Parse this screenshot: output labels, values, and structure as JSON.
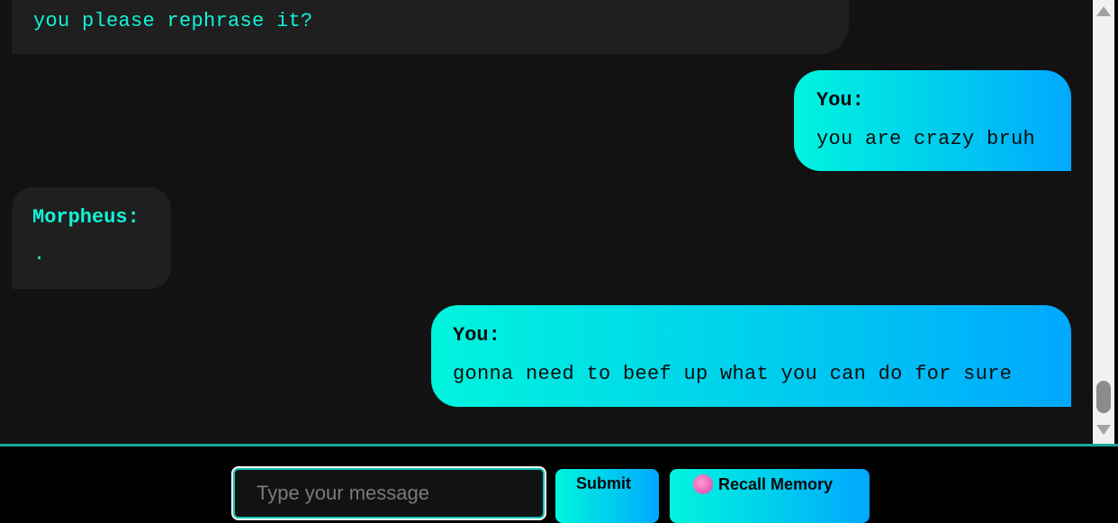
{
  "conversation": {
    "messages": [
      {
        "role": "bot",
        "speaker": "",
        "text": "you please rephrase it?"
      },
      {
        "role": "user",
        "speaker": "You:",
        "text": "you are crazy bruh"
      },
      {
        "role": "bot",
        "speaker": "Morpheus:",
        "text": "."
      },
      {
        "role": "user",
        "speaker": "You:",
        "text": "gonna need to beef up what you can do for sure"
      }
    ]
  },
  "input": {
    "placeholder": "Type your message",
    "value": ""
  },
  "buttons": {
    "submit_label": "Submit",
    "recall_label": "Recall Memory",
    "recall_icon": "brain-icon"
  },
  "colors": {
    "background": "#121212",
    "bot_bubble": "#1f1f1f",
    "bot_text": "#11f5d8",
    "user_gradient_start": "#00f5dd",
    "user_gradient_end": "#00a8ff",
    "accent_border": "#16a898"
  }
}
